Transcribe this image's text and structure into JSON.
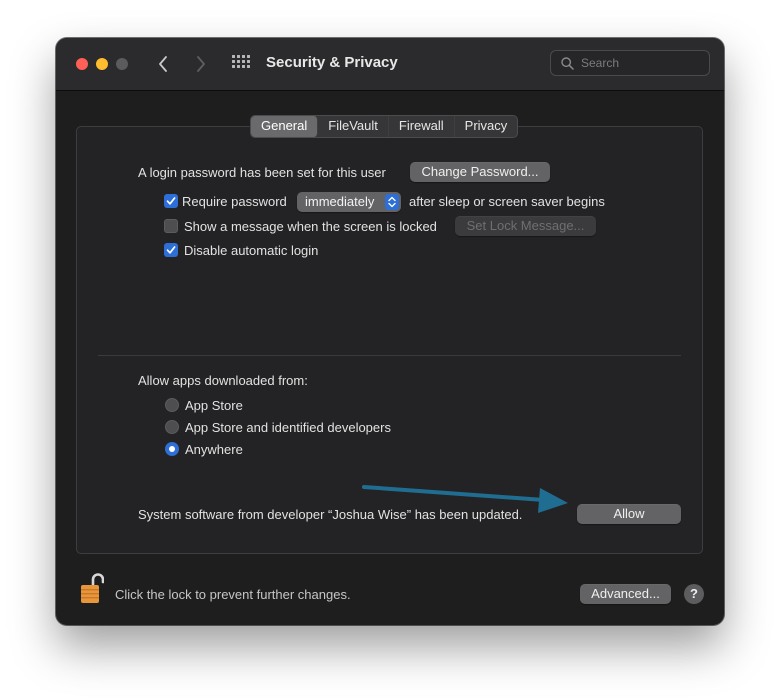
{
  "window": {
    "title": "Security & Privacy",
    "traffic_lights": {
      "close_color": "#fe5f57",
      "minimize_color": "#febc2e",
      "zoom_color": "#5b5b5e"
    }
  },
  "search": {
    "placeholder": "Search",
    "value": ""
  },
  "tabs": [
    {
      "label": "General",
      "active": true
    },
    {
      "label": "FileVault",
      "active": false
    },
    {
      "label": "Firewall",
      "active": false
    },
    {
      "label": "Privacy",
      "active": false
    }
  ],
  "general": {
    "login_password_text": "A login password has been set for this user",
    "change_password_button": "Change Password...",
    "require_password": {
      "checked": true,
      "label": "Require password",
      "selected_option": "immediately",
      "suffix": "after sleep or screen saver begins"
    },
    "show_message": {
      "checked": false,
      "label": "Show a message when the screen is locked",
      "button": "Set Lock Message...",
      "button_enabled": false
    },
    "disable_auto_login": {
      "checked": true,
      "label": "Disable automatic login"
    }
  },
  "allow_apps": {
    "heading": "Allow apps downloaded from:",
    "options": [
      {
        "label": "App Store",
        "selected": false
      },
      {
        "label": "App Store and identified developers",
        "selected": false
      },
      {
        "label": "Anywhere",
        "selected": true
      }
    ]
  },
  "system_software": {
    "message": "System software from developer “Joshua Wise” has been updated.",
    "allow_button": "Allow",
    "annotation_arrow_color": "#1f6e92"
  },
  "footer": {
    "lock_text": "Click the lock to prevent further changes.",
    "advanced_button": "Advanced...",
    "help_button": "?"
  },
  "colors": {
    "accent": "#2d6fd6",
    "lock_icon": "#e8963a"
  },
  "icons": [
    "chevron-left-icon",
    "chevron-right-icon",
    "grid-icon",
    "search-icon",
    "checkmark-icon",
    "stepper-icon",
    "unlocked-padlock-icon"
  ]
}
